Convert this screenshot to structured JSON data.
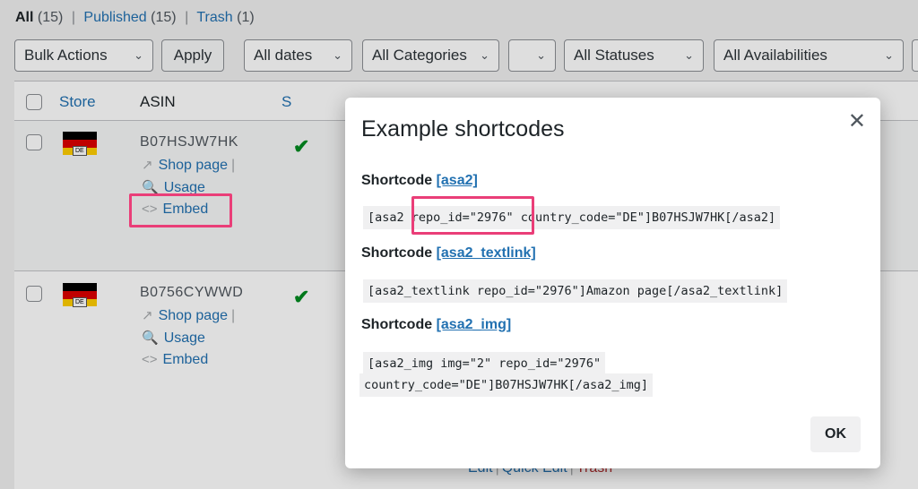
{
  "status_links": {
    "all_label": "All",
    "all_count": "(15)",
    "published_label": "Published",
    "published_count": "(15)",
    "trash_label": "Trash",
    "trash_count": "(1)",
    "separator": "|"
  },
  "filters": {
    "bulk_actions": "Bulk Actions",
    "apply": "Apply",
    "dates": "All dates",
    "categories": "All Categories",
    "blank": "",
    "statuses": "All Statuses",
    "availabilities": "All Availabilities"
  },
  "table": {
    "headers": {
      "store": "Store",
      "asin": "ASIN",
      "s": "S"
    },
    "rows": [
      {
        "flag_tag": "DE",
        "asin": "B07HSJW7HK",
        "shop_page": "Shop page",
        "usage": "Usage",
        "embed": "Embed"
      },
      {
        "flag_tag": "DE",
        "asin": "B0756CYWWD",
        "shop_page": "Shop page",
        "usage": "Usage",
        "embed": "Embed"
      }
    ],
    "check_glyph": "✔",
    "pipe": "|",
    "row_links": {
      "edit": "Edit",
      "quick_edit": "Quick Edit",
      "trash": "Trash",
      "bar": "|"
    }
  },
  "icons": {
    "shop_page": "↗",
    "usage": "🔍",
    "embed": "<>",
    "chevron": "⌄",
    "close": "✕"
  },
  "modal": {
    "title": "Example shortcodes",
    "shortcode_word": "Shortcode",
    "sc1": {
      "name": "[asa2]",
      "code_start": "[asa2 ",
      "code_highlight": "repo_id=\"2976\"",
      "code_end": " country_code=\"DE\"]B07HSJW7HK[/asa2]"
    },
    "sc2": {
      "name": "[asa2_textlink]",
      "code": "[asa2_textlink repo_id=\"2976\"]Amazon page[/asa2_textlink]"
    },
    "sc3": {
      "name": "[asa2_img]",
      "code_line1": "[asa2_img img=\"2\" repo_id=\"2976\"",
      "code_line2": "country_code=\"DE\"]B07HSJW7HK[/asa2_img]"
    },
    "ok": "OK"
  },
  "colors": {
    "highlight": "#ea3e78",
    "link": "#2271b1",
    "check": "#008a20"
  }
}
